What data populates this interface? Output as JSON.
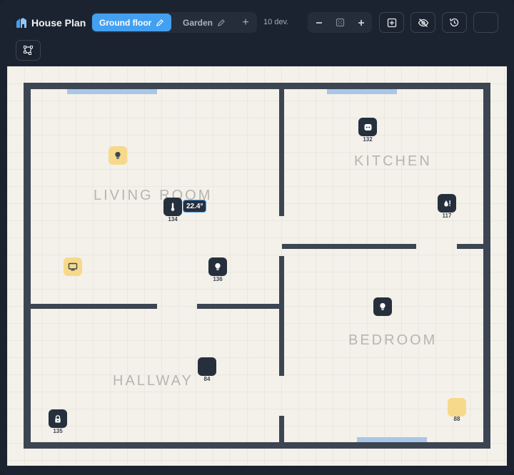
{
  "app": {
    "title": "House Plan"
  },
  "floors": {
    "active_label": "Ground floor",
    "second_label": "Garden",
    "add_label": "+"
  },
  "device_count": "10 dev.",
  "rooms": {
    "living": "LIVING ROOM",
    "kitchen": "KITCHEN",
    "bedroom": "BEDROOM",
    "hallway": "HALLWAY"
  },
  "devices": {
    "kitchen_plug_num": "132",
    "thermo_num": "134",
    "thermo_reading": "22.4°",
    "humidity_num": "117",
    "living_light_num": "136",
    "hall_dev_num": "84",
    "lock_num": "135",
    "bedroom_lamp_num": "88"
  },
  "colors": {
    "accent": "#43a0f0",
    "device_on": "#f6d98a",
    "device_off": "#26303d",
    "wall": "#3c4552",
    "window": "#a9c6e6"
  }
}
